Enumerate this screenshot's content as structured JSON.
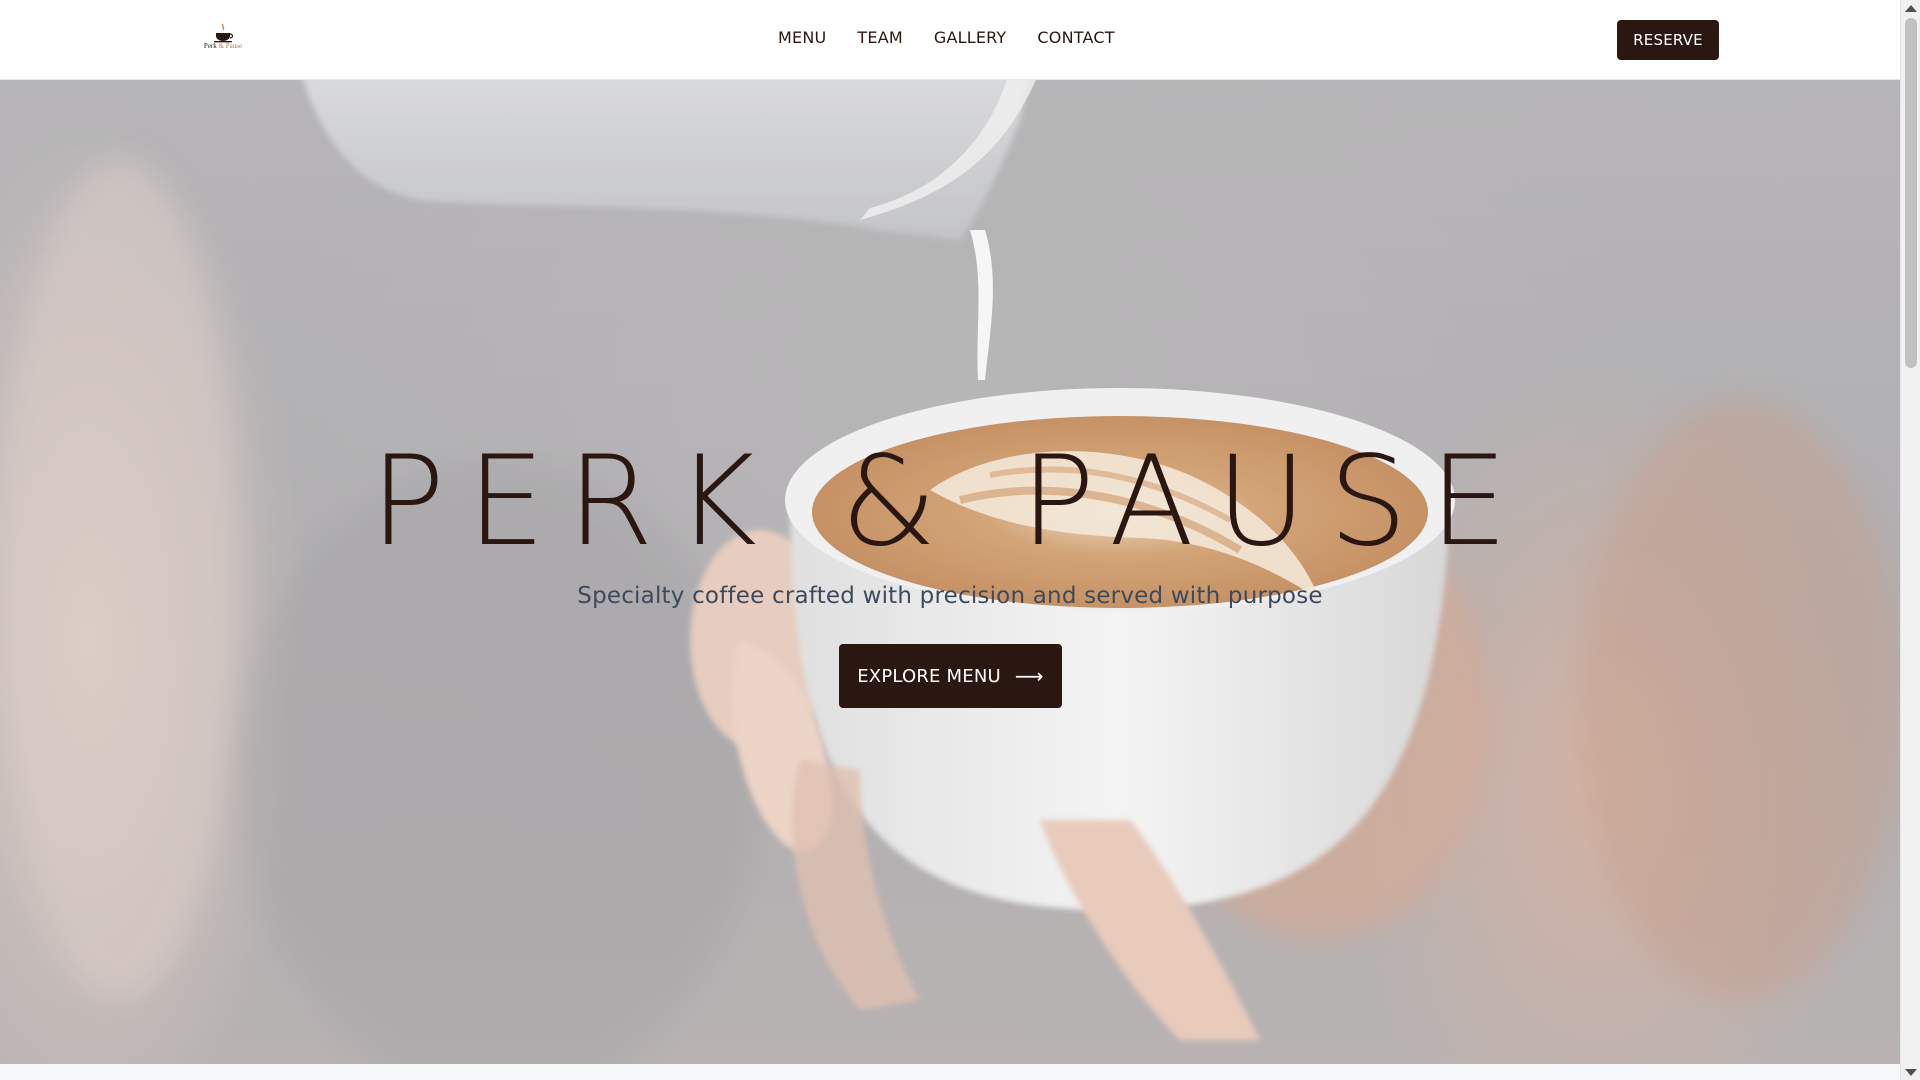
{
  "brand": {
    "logo_name": "Perk",
    "logo_amp": "&",
    "logo_name2": "Pause"
  },
  "nav": {
    "items": [
      {
        "label": "MENU"
      },
      {
        "label": "TEAM"
      },
      {
        "label": "GALLERY"
      },
      {
        "label": "CONTACT"
      }
    ],
    "reserve_label": "RESERVE"
  },
  "hero": {
    "title": "PERK & PAUSE",
    "subtitle": "Specialty coffee crafted with precision and served with purpose",
    "cta_label": "EXPLORE MENU",
    "cta_icon": "arrow-right-icon"
  },
  "colors": {
    "brand_dark": "#2b1712",
    "subtitle": "#3e4a5c",
    "header_bg": "#ffffff"
  }
}
